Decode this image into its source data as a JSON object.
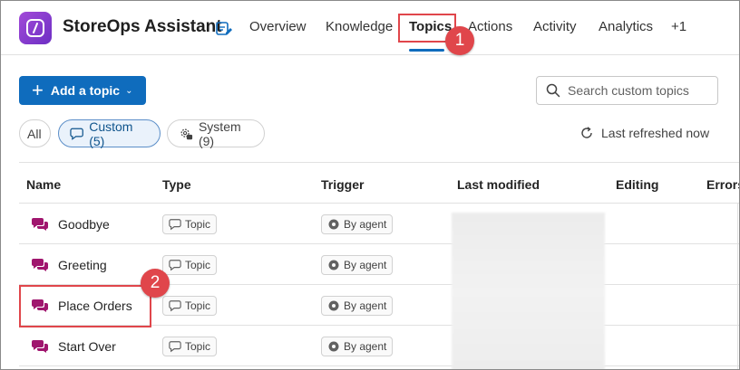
{
  "header": {
    "app_title": "StoreOps Assistant",
    "tabs": [
      {
        "label": "Overview"
      },
      {
        "label": "Knowledge"
      },
      {
        "label": "Topics",
        "active": true
      },
      {
        "label": "Actions"
      },
      {
        "label": "Activity"
      },
      {
        "label": "Analytics"
      },
      {
        "label": "+1"
      }
    ]
  },
  "toolbar": {
    "add_topic_label": "Add a topic",
    "search_placeholder": "Search custom topics"
  },
  "filters": {
    "all": "All",
    "custom": "Custom (5)",
    "system": "System (9)",
    "refresh_label": "Last refreshed now"
  },
  "table": {
    "columns": [
      "Name",
      "Type",
      "Trigger",
      "Last modified",
      "Editing",
      "Errors"
    ],
    "rows": [
      {
        "name": "Goodbye",
        "type": "Topic",
        "trigger": "By agent"
      },
      {
        "name": "Greeting",
        "type": "Topic",
        "trigger": "By agent"
      },
      {
        "name": "Place Orders",
        "type": "Topic",
        "trigger": "By agent"
      },
      {
        "name": "Start Over",
        "type": "Topic",
        "trigger": "By agent"
      }
    ]
  },
  "annotations": {
    "badge_1": "1",
    "badge_2": "2"
  },
  "colors": {
    "accent": "#0f6cbd",
    "annotation": "#e0464b",
    "topic_icon": "#a0156e"
  }
}
